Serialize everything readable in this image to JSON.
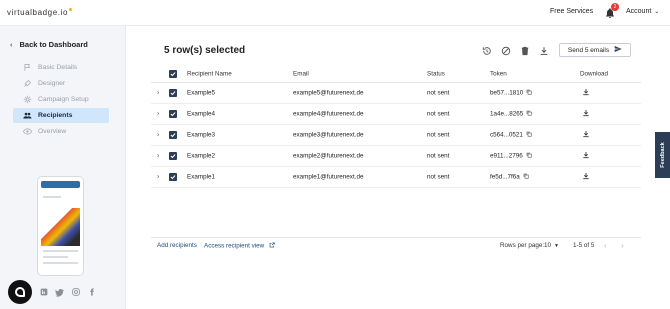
{
  "header": {
    "logo": "virtualbadge.io",
    "free_services": "Free Services",
    "notification_count": "2",
    "account": "Account"
  },
  "sidebar": {
    "back_label": "Back to Dashboard",
    "items": [
      {
        "label": "Basic Details",
        "icon": "flag-icon"
      },
      {
        "label": "Designer",
        "icon": "brush-icon"
      },
      {
        "label": "Campaign Setup",
        "icon": "gear-icon"
      },
      {
        "label": "Recipients",
        "icon": "people-icon"
      },
      {
        "label": "Overview",
        "icon": "eye-icon"
      }
    ]
  },
  "main": {
    "title": "5 row(s) selected",
    "send_button": "Send 5 emails",
    "columns": [
      "Recipient Name",
      "Email",
      "Status",
      "Token",
      "Download"
    ],
    "rows": [
      {
        "name": "Example5",
        "email": "example5@futurenext.de",
        "status": "not sent",
        "token": "be57...1810"
      },
      {
        "name": "Example4",
        "email": "example4@futurenext.de",
        "status": "not sent",
        "token": "1a4e...8265"
      },
      {
        "name": "Example3",
        "email": "example3@futurenext.de",
        "status": "not sent",
        "token": "c564...0521"
      },
      {
        "name": "Example2",
        "email": "example2@futurenext.de",
        "status": "not sent",
        "token": "e911...2796"
      },
      {
        "name": "Example1",
        "email": "example1@futurenext.de",
        "status": "not sent",
        "token": "fe5d...7f6a"
      }
    ]
  },
  "footer": {
    "add_recipients": "Add recipients",
    "access_recipient_view": "Access recipient view",
    "rows_per_page_label": "Rows per page:",
    "rows_per_page_value": "10",
    "range": "1-5 of 5"
  },
  "feedback_label": "Feedback",
  "colors": {
    "accent_dark": "#2c3e55",
    "active_item_bg": "#cfe6fb",
    "badge_red": "#e53935",
    "sidebar_bg": "#f3f5f8"
  }
}
